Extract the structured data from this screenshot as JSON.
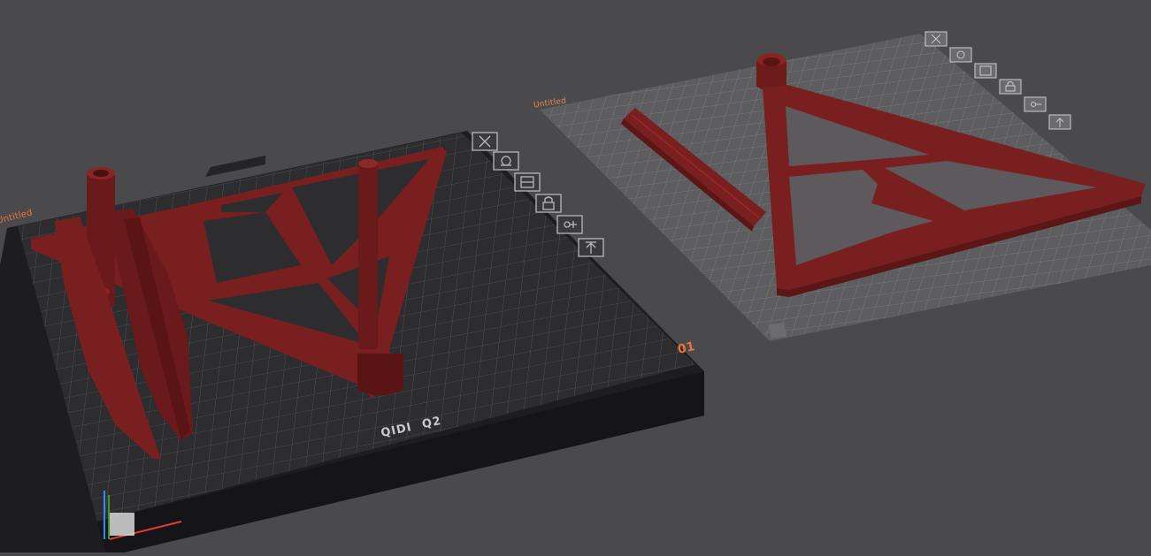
{
  "plates": [
    {
      "name": "Untitled",
      "number": "01",
      "brand": "QIDI",
      "model": "Q2"
    },
    {
      "name": "Untitled"
    }
  ],
  "plate_tools": [
    "close-icon",
    "auto-orient-icon",
    "arrange-icon",
    "lock-icon",
    "settings-icon",
    "move-to-top-icon"
  ],
  "colors": {
    "background": "#4a4a4c",
    "plate_dark": "#2b2b2d",
    "plate_light": "#6a6a6c",
    "grid_dark": "#4c4c4e",
    "grid_light": "#7a7a7c",
    "model": "#7a1f1f",
    "accent": "#e8743a"
  }
}
